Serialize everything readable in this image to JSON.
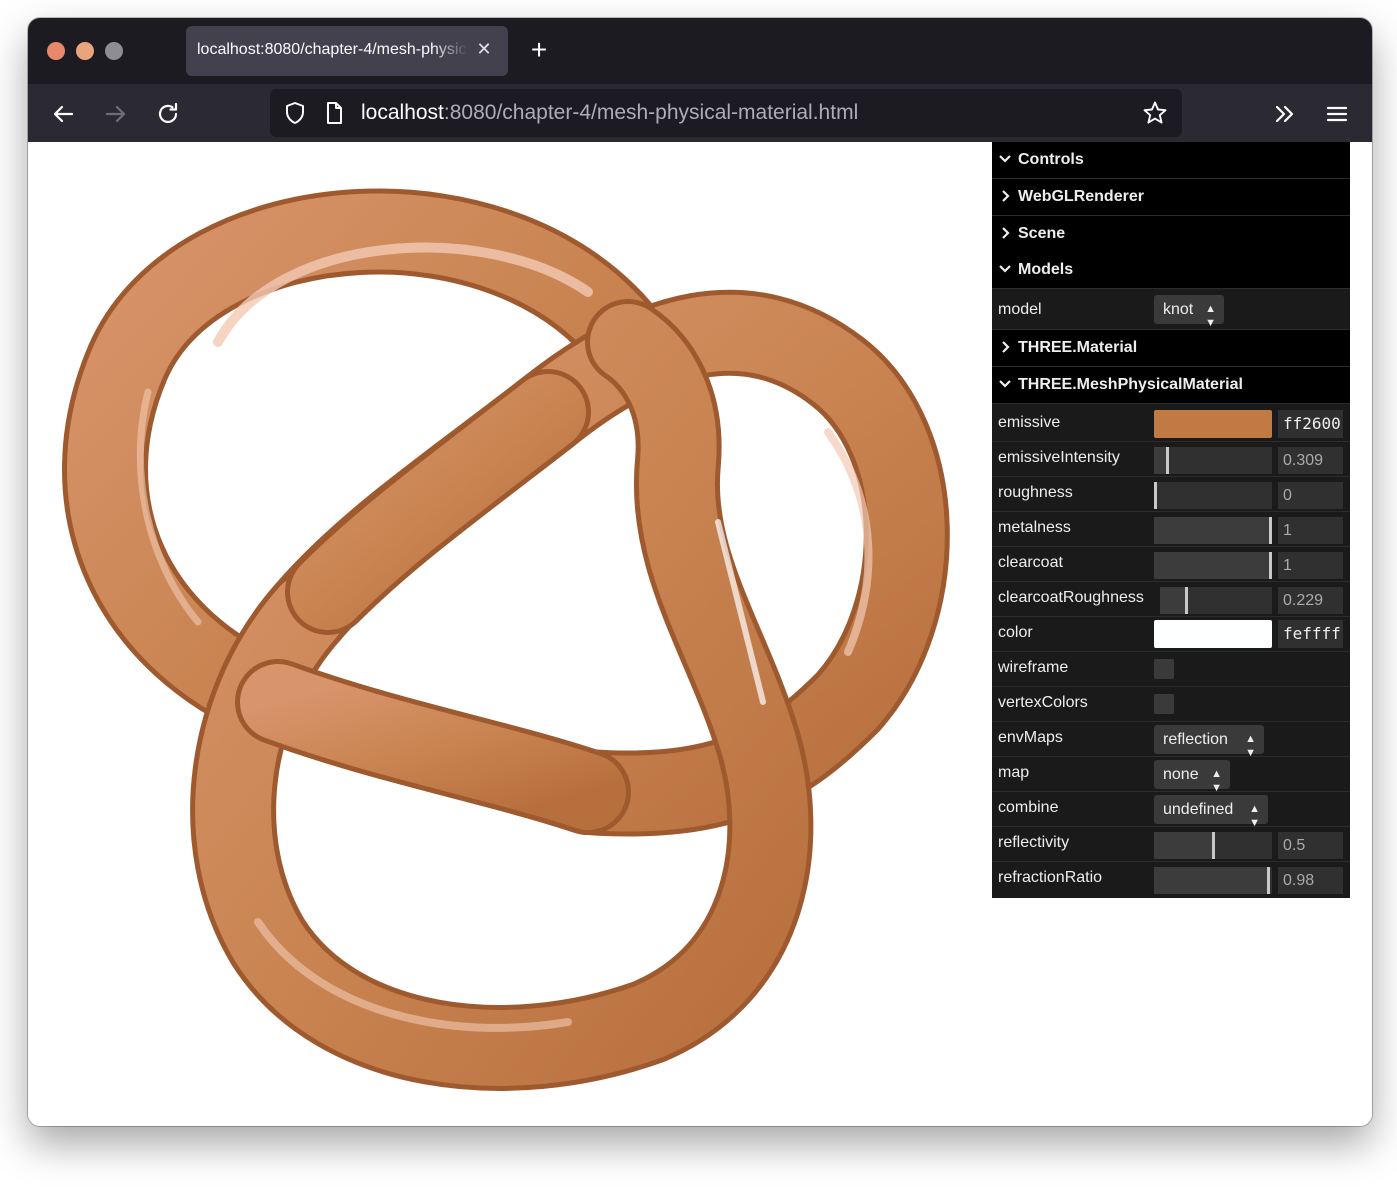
{
  "browser": {
    "tab_title": "localhost:8080/chapter-4/mesh-physical-material.html",
    "url_host": "localhost",
    "url_rest": ":8080/chapter-4/mesh-physical-material.html"
  },
  "gui": {
    "folders": {
      "controls": "Controls",
      "webgl_renderer": "WebGLRenderer",
      "scene": "Scene",
      "models": "Models",
      "three_material": "THREE.Material",
      "mesh_physical_material": "THREE.MeshPhysicalMaterial"
    },
    "model": {
      "label": "model",
      "value": "knot"
    },
    "emissive": {
      "label": "emissive",
      "value": "ff2600",
      "swatch_color": "#c27a44"
    },
    "emissiveIntensity": {
      "label": "emissiveIntensity",
      "value": "0.309",
      "fraction": 0.309
    },
    "roughness": {
      "label": "roughness",
      "value": "0",
      "fraction": 0
    },
    "metalness": {
      "label": "metalness",
      "value": "1",
      "fraction": 1
    },
    "clearcoat": {
      "label": "clearcoat",
      "value": "1",
      "fraction": 1
    },
    "clearcoatRoughness": {
      "label": "clearcoatRoughness",
      "value": "0.229",
      "fraction": 0.229
    },
    "color": {
      "label": "color",
      "value": "feffff",
      "swatch_color": "#feffff"
    },
    "wireframe": {
      "label": "wireframe",
      "checked": false
    },
    "vertexColors": {
      "label": "vertexColors",
      "checked": false
    },
    "envMaps": {
      "label": "envMaps",
      "value": "reflection"
    },
    "map": {
      "label": "map",
      "value": "none"
    },
    "combine": {
      "label": "combine",
      "value": "undefined"
    },
    "reflectivity": {
      "label": "reflectivity",
      "value": "0.5",
      "fraction": 0.5
    },
    "refractionRatio": {
      "label": "refractionRatio",
      "value": "0.98",
      "fraction": 0.98
    }
  },
  "colors": {
    "knot_base": "#c98452",
    "knot_dark": "#9e5a2e",
    "knot_light": "#f2c9b3"
  }
}
